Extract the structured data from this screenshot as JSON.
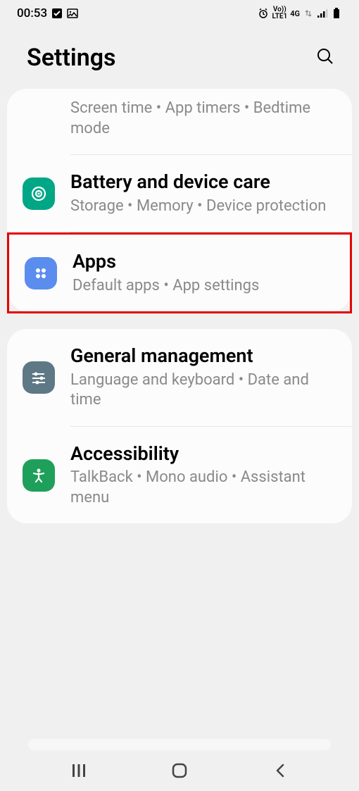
{
  "status": {
    "time": "00:53",
    "network": "4G",
    "lte": "LTE1",
    "vo": "Vo))"
  },
  "header": {
    "title": "Settings"
  },
  "group1": {
    "partial_sub": "Screen time  •  App timers  •  Bedtime mode",
    "battery": {
      "title": "Battery and device care",
      "sub": "Storage  •  Memory  •  Device protection"
    },
    "apps": {
      "title": "Apps",
      "sub": "Default apps  •  App settings"
    }
  },
  "group2": {
    "general": {
      "title": "General management",
      "sub": "Language and keyboard  •  Date and time"
    },
    "accessibility": {
      "title": "Accessibility",
      "sub": "TalkBack  •  Mono audio  •  Assistant menu"
    }
  }
}
